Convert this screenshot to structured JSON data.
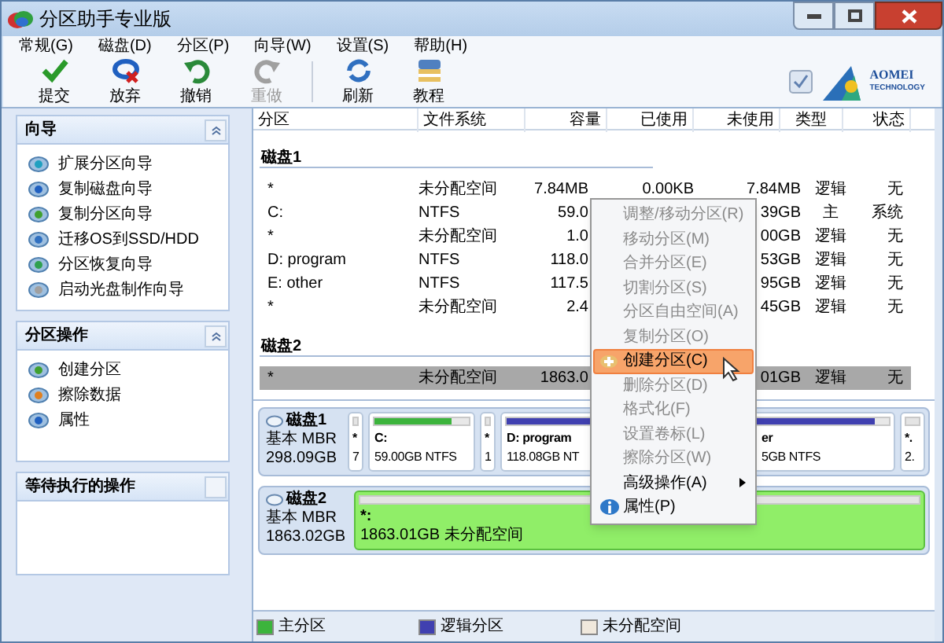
{
  "window": {
    "title": "分区助手专业版"
  },
  "menu_bar": [
    "常规(G)",
    "磁盘(D)",
    "分区(P)",
    "向导(W)",
    "设置(S)",
    "帮助(H)"
  ],
  "toolbar": [
    {
      "label": "提交",
      "disabled": false
    },
    {
      "label": "放弃",
      "disabled": false
    },
    {
      "label": "撤销",
      "disabled": false
    },
    {
      "label": "重做",
      "disabled": true
    },
    {
      "label": "刷新",
      "disabled": false
    },
    {
      "label": "教程",
      "disabled": false
    }
  ],
  "logo": {
    "name": "AOMEI",
    "tagline": "TECHNOLOGY"
  },
  "sidebar": {
    "sections": [
      {
        "title": "向导",
        "kind": "list",
        "items": [
          "扩展分区向导",
          "复制磁盘向导",
          "复制分区向导",
          "迁移OS到SSD/HDD",
          "分区恢复向导",
          "启动光盘制作向导"
        ]
      },
      {
        "title": "分区操作",
        "kind": "list",
        "items": [
          "创建分区",
          "擦除数据",
          "属性"
        ]
      },
      {
        "title": "等待执行的操作",
        "kind": "pending"
      }
    ]
  },
  "table": {
    "columns": [
      "分区",
      "文件系统",
      "容量",
      "已使用",
      "未使用",
      "类型",
      "状态"
    ],
    "groups": [
      {
        "title": "磁盘1",
        "rows": [
          {
            "partition": "*",
            "file_system": "未分配空间",
            "capacity": "7.84MB",
            "used": "0.00KB",
            "unused": "7.84MB",
            "type": "逻辑",
            "status": "无",
            "selected": false
          },
          {
            "partition": "C:",
            "file_system": "NTFS",
            "capacity": "59.0",
            "unused": "39GB",
            "type": "主",
            "status": "系统",
            "selected": false
          },
          {
            "partition": "*",
            "file_system": "未分配空间",
            "capacity": "1.0",
            "unused": "00GB",
            "type": "逻辑",
            "status": "无",
            "selected": false
          },
          {
            "partition": "D: program",
            "file_system": "NTFS",
            "capacity": "118.0",
            "unused": "53GB",
            "type": "逻辑",
            "status": "无",
            "selected": false
          },
          {
            "partition": "E: other",
            "file_system": "NTFS",
            "capacity": "117.5",
            "unused": "95GB",
            "type": "逻辑",
            "status": "无",
            "selected": false
          },
          {
            "partition": "*",
            "file_system": "未分配空间",
            "capacity": "2.4",
            "unused": "45GB",
            "type": "逻辑",
            "status": "无",
            "selected": false
          }
        ]
      },
      {
        "title": "磁盘2",
        "rows": [
          {
            "partition": "*",
            "file_system": "未分配空间",
            "capacity": "1863.0",
            "unused": "01GB",
            "type": "逻辑",
            "status": "无",
            "selected": true
          }
        ]
      }
    ]
  },
  "disk_map": {
    "disks": [
      {
        "name": "磁盘1",
        "scheme": "基本 MBR",
        "size": "298.09GB",
        "selected": false,
        "partitions": [
          {
            "kind": "unallocated",
            "line1": "*",
            "line2": "7"
          },
          {
            "kind": "primary",
            "line1": "C:",
            "line2": "59.00GB NTFS",
            "level": 0.82
          },
          {
            "kind": "unallocated",
            "line1": "*",
            "line2": "1"
          },
          {
            "kind": "logical",
            "line1": "D: program",
            "line2": "118.08GB NT",
            "level": 1
          },
          {
            "kind": "logical",
            "line1": "er",
            "line2": "5GB NTFS",
            "level": 0.94
          },
          {
            "kind": "unallocated",
            "line1": "*.",
            "line2": "2."
          }
        ]
      },
      {
        "name": "磁盘2",
        "scheme": "基本 MBR",
        "size": "1863.02GB",
        "selected": true,
        "partitions": [
          {
            "kind": "unallocated",
            "line1": "*:",
            "line2": "1863.01GB 未分配空间"
          }
        ]
      }
    ]
  },
  "legend": [
    {
      "label": "主分区",
      "color": "#3cb43c"
    },
    {
      "label": "逻辑分区",
      "color": "#4040b0"
    },
    {
      "label": "未分配空间",
      "color": "#f0e8dc"
    }
  ],
  "context_menu": {
    "items": [
      {
        "label": "调整/移动分区(R)",
        "kind": "item",
        "disabled": true,
        "selected": false
      },
      {
        "label": "移动分区(M)",
        "kind": "item",
        "disabled": true,
        "selected": false
      },
      {
        "label": "合并分区(E)",
        "kind": "item",
        "disabled": true,
        "selected": false
      },
      {
        "label": "切割分区(S)",
        "kind": "item",
        "disabled": true,
        "selected": false
      },
      {
        "label": "分区自由空间(A)",
        "kind": "item",
        "disabled": true,
        "selected": false
      },
      {
        "label": "复制分区(O)",
        "kind": "item",
        "disabled": true,
        "selected": false
      },
      {
        "label": "创建分区(C)",
        "kind": "create",
        "disabled": false,
        "selected": true
      },
      {
        "label": "删除分区(D)",
        "kind": "item",
        "disabled": true,
        "selected": false
      },
      {
        "label": "格式化(F)",
        "kind": "item",
        "disabled": true,
        "selected": false
      },
      {
        "label": "设置卷标(L)",
        "kind": "item",
        "disabled": true,
        "selected": false
      },
      {
        "label": "擦除分区(W)",
        "kind": "item",
        "disabled": true,
        "selected": false
      },
      {
        "label": "高级操作(A)",
        "kind": "submenu",
        "disabled": false,
        "selected": false
      },
      {
        "label": "属性(P)",
        "kind": "info",
        "disabled": false,
        "selected": false
      }
    ]
  }
}
